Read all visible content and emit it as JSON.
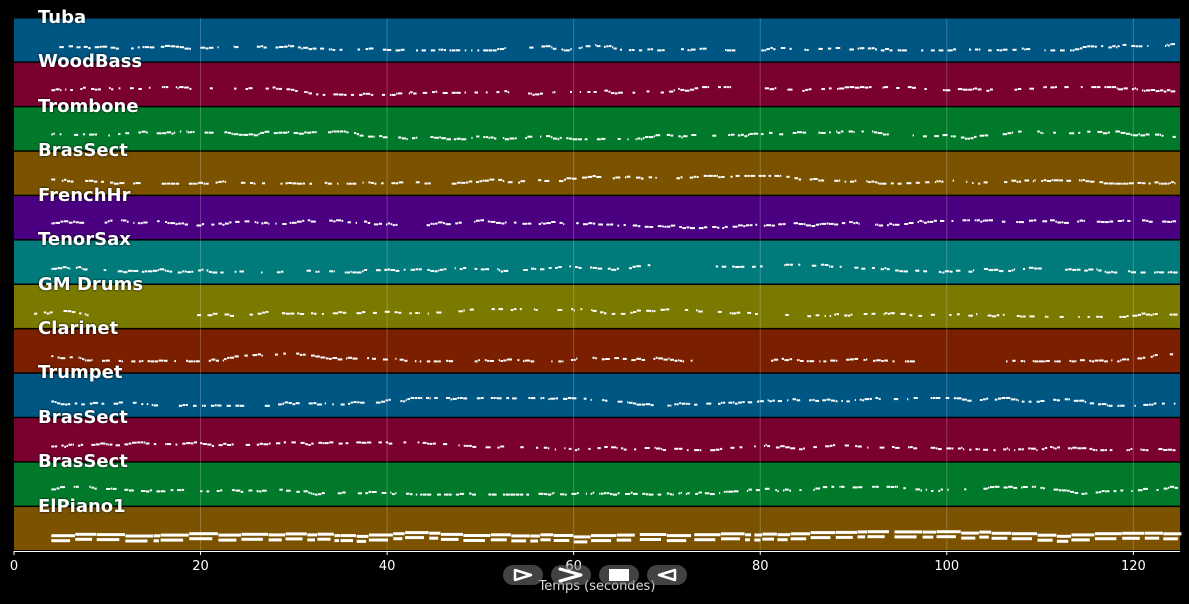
{
  "chart_data": {
    "type": "piano-roll",
    "xlabel": "Temps (secondes)",
    "xlim": [
      0,
      125
    ],
    "x_ticks": [
      0,
      20,
      40,
      60,
      80,
      100,
      120
    ],
    "tracks": [
      {
        "name": "Tuba",
        "color": "#005682",
        "note_start": 3.5,
        "density": 0.55,
        "gaps": [
          [
            77,
            80
          ]
        ]
      },
      {
        "name": "WoodBass",
        "color": "#7a0030",
        "note_start": 3.5,
        "density": 0.55,
        "gaps": [
          [
            77,
            80
          ]
        ]
      },
      {
        "name": "Trombone",
        "color": "#007a2a",
        "note_start": 4.0,
        "density": 0.6,
        "gaps": []
      },
      {
        "name": "BrasSect",
        "color": "#7a5200",
        "note_start": 4.0,
        "density": 0.6,
        "gaps": []
      },
      {
        "name": "FrenchHr",
        "color": "#4a0080",
        "note_start": 4.0,
        "density": 0.65,
        "gaps": []
      },
      {
        "name": "TenorSax",
        "color": "#007a7a",
        "note_start": 4.0,
        "density": 0.55,
        "gaps": [
          [
            69,
            75
          ]
        ]
      },
      {
        "name": "GM Drums",
        "color": "#7a7a00",
        "note_start": 1.5,
        "density": 0.4,
        "gaps": [
          [
            11,
            18
          ]
        ]
      },
      {
        "name": "Clarinet",
        "color": "#7a2000",
        "note_start": 4.0,
        "density": 0.55,
        "gaps": [
          [
            73,
            80
          ],
          [
            97,
            105
          ]
        ]
      },
      {
        "name": "Trumpet",
        "color": "#005682",
        "note_start": 4.0,
        "density": 0.55,
        "gaps": []
      },
      {
        "name": "BrasSect",
        "color": "#7a0030",
        "note_start": 4.0,
        "density": 0.6,
        "gaps": []
      },
      {
        "name": "BrasSect",
        "color": "#007a2a",
        "note_start": 4.0,
        "density": 0.55,
        "gaps": []
      },
      {
        "name": "ElPiano1",
        "color": "#7a5200",
        "note_start": 4.0,
        "density": 0.95,
        "gaps": []
      }
    ]
  },
  "controls": [
    {
      "name": "play-button",
      "icon": "play-icon"
    },
    {
      "name": "fast-forward-button",
      "icon": "chevron-right-icon"
    },
    {
      "name": "stop-button",
      "icon": "stop-icon"
    },
    {
      "name": "rewind-button",
      "icon": "chevron-left-icon"
    }
  ]
}
